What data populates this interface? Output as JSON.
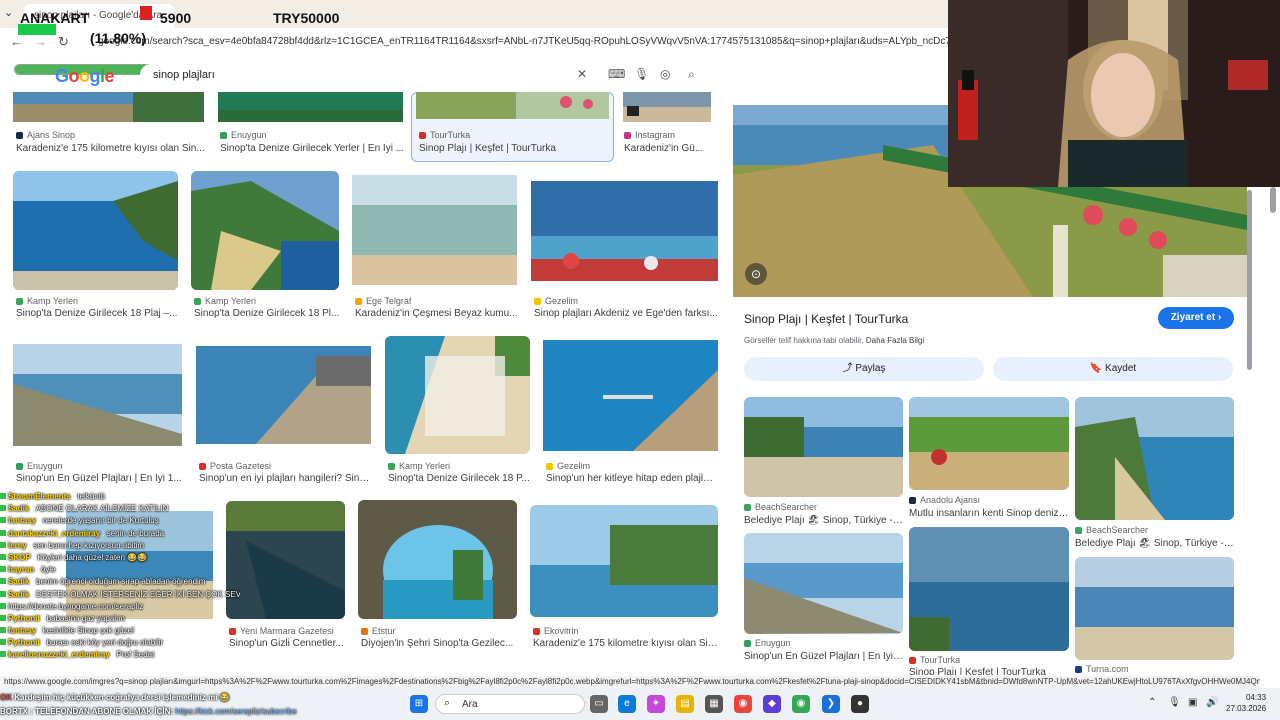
{
  "overlay": {
    "label": "ANAKART",
    "value": "5900",
    "goal": "TRY50000",
    "percent": "(11.80%)",
    "progress_fraction": 0.118
  },
  "browser": {
    "tab_title": "sinop plajları - Google'da Ara",
    "url": "google.com/search?sca_esv=4e0bfa84728bf4dd&rlz=1C1GCEA_enTR1164TR1164&sxsrf=ANbL-n7JTKeU5qq-ROpuhLOSyVWqvV5nVA:1774575131085&q=sinop+plajları&uds=ALYpb_ncDc7jTlmw6Mmq7Nj"
  },
  "search": {
    "query": "sinop plajları",
    "logo": "Google"
  },
  "grid": [
    {
      "source": "Ajans Sinop",
      "title": "Karadeniz'e 175 kilometre kıyısı olan Sin...",
      "color": "#1a2a4a"
    },
    {
      "source": "Enuygun",
      "title": "Sinop'ta Denize Girilecek Yerler | En İyi ...",
      "color": "#2e9e5e"
    },
    {
      "source": "TourTurka",
      "title": "Sinop Plajı | Keşfet | TourTurka",
      "color": "#d93025"
    },
    {
      "source": "Instagram",
      "title": "Karadeniz'in Gü...",
      "color": "#c13584"
    },
    {
      "source": "Kamp Yerleri",
      "title": "Sinop'ta Denize Girilecek 18 Plaj –...",
      "color": "#3aa35b"
    },
    {
      "source": "Kamp Yerleri",
      "title": "Sinop'ta Denize Girilecek 18 Pl...",
      "color": "#3aa35b"
    },
    {
      "source": "Ege Telgraf",
      "title": "Karadeniz'in Çeşmesi Beyaz kumu...",
      "color": "#f4a300"
    },
    {
      "source": "Gezelim",
      "title": "Sinop plajları Akdeniz ve Ege'den farksı...",
      "color": "#f4c300"
    },
    {
      "source": "Enuygun",
      "title": "Sinop'un En Güzel Plajları | En İyi 1...",
      "color": "#2e9e5e"
    },
    {
      "source": "Posta Gazetesi",
      "title": "Sinop'un en iyi plajları hangileri? Sino...",
      "color": "#d93025"
    },
    {
      "source": "Kamp Yerleri",
      "title": "Sinop'ta Denize Girilecek 18 P...",
      "color": "#3aa35b"
    },
    {
      "source": "Gezelim",
      "title": "Sinop'un her kitleye hitap eden plajlar...",
      "color": "#f4c300"
    },
    {
      "source": "Yeni Marmara Gazetesi",
      "title": "Sinop'un Gizli Cennetler...",
      "color": "#d93025"
    },
    {
      "source": "Etstur",
      "title": "Diyojen'in Şehri Sinop'ta Gezilec...",
      "color": "#e8710a"
    },
    {
      "source": "Ekovitrin",
      "title": "Karadeniz'e 175 kilometre kıyısı olan Sin...",
      "color": "#d93025"
    }
  ],
  "panel": {
    "title": "Sinop Plajı | Keşfet | TourTurka",
    "visit_label": "Ziyaret et",
    "copyright_note": "Görseller telif hakkına tabi olabilir.",
    "more_info": "Daha Fazla Bilgi",
    "share_label": "Paylaş",
    "save_label": "Kaydet",
    "related": [
      {
        "source": "BeachSearcher",
        "title": "Belediye Plajı 🏖 Sinop, Türkiye - detay..."
      },
      {
        "source": "Anadolu Ajansı",
        "title": "Mutlu insanların kenti Sinop denizliyle..."
      },
      {
        "source": "BeachSearcher",
        "title": "Belediye Plajı 🏖 Sinop, Türkiye - detay..."
      },
      {
        "source": "Enuygun",
        "title": "Sinop'un En Güzel Plajları | En İyi 10 Plaj..."
      },
      {
        "source": "TourTurka",
        "title": "Sinop Plajı | Keşfet | TourTurka"
      },
      {
        "source": "Turna.com",
        "title": ""
      }
    ]
  },
  "chat": [
    {
      "user": "StreamElements",
      "msg": "telkünlü"
    },
    {
      "user": "Sadik",
      "msg": "ABONE OLARAK AİLEMİZE KATILIN"
    },
    {
      "user": "fantasy",
      "msg": "nerelerde yaşanır bir de Kurtuluş"
    },
    {
      "user": "dantakazzeki_erdemiray",
      "msg": "senin de burada"
    },
    {
      "user": "lerey",
      "msg": "sen bana hep kızıyorsun abitim"
    },
    {
      "user": "SKOP",
      "msg": "Köyleri daha güzel zaten 😂😂"
    },
    {
      "user": "hayran",
      "msg": "öyle"
    },
    {
      "user": "Sadik",
      "msg": "benim öğrenci olduğum sırap abladan öğrendim"
    },
    {
      "user": "Sadik",
      "msg": "DESTEK OLMAK İSTERSENİZ EĞER İKİ BEN ÇOK SEVERİM"
    },
    {
      "user": "",
      "msg": "https://donate.bynogame.com/serapliz"
    },
    {
      "user": "Pythonit",
      "msg": "babasına gaz yapalım"
    },
    {
      "user": "fantasy",
      "msg": "kesinlikle Sinop çok güzel"
    },
    {
      "user": "Pythonit",
      "msg": "burası eski köy yeri doğru olabilir"
    },
    {
      "user": "kareliosnuzzeki_erdemiray",
      "msg": "Prof Sedat"
    }
  ],
  "status_url": "https://www.google.com/imgres?q=sinop plajları&imgurl=https%3A%2F%2Fwww.tourturka.com%2Fimages%2Fdestinations%2Fbig%2Fayl8fi2p0c%2Fayl8fi2p0c.webp&imgrefurl=https%3A%2F%2Fwww.tourturka.com%2Fkesfet%2Ftuna-plaji-sinop&docid=CiSEDIDKY41sbM&tbnid=DWfd8wnNTP-UpM&vet=12ahUKEwjHtoLU976TAxXfgvOHHWe0MJ4Qn",
  "ticker": {
    "line1_user": "OK",
    "line1": "Kardeşim hiç küçükken coğrafya dersi işlemediniz mi 😂",
    "line2": "BORTX : TELEFONDAN ABONE OLMAK İÇİN:",
    "line2_link": "https://kick.com/serapliz/subscribe"
  },
  "taskbar": {
    "search_placeholder": "Ara",
    "time": "04:33",
    "date": "27.03.2026"
  }
}
